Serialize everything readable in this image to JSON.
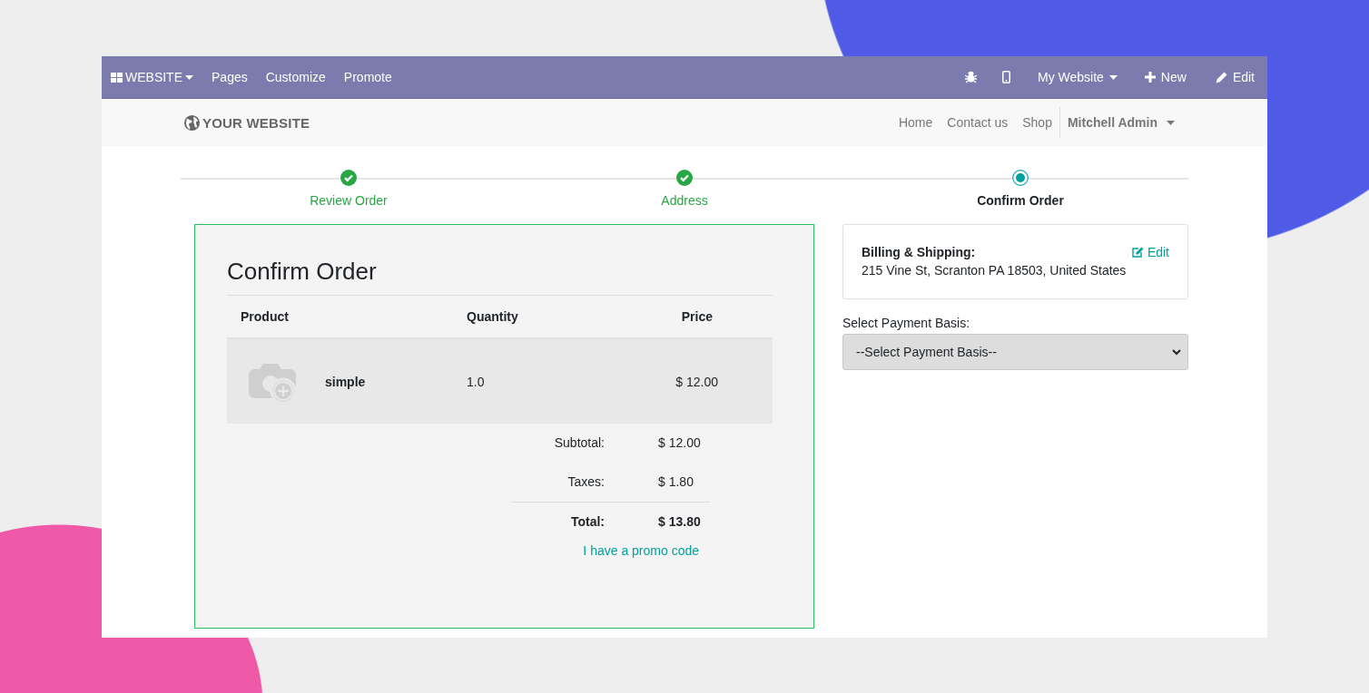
{
  "admin_bar": {
    "app_menu": "WEBSITE",
    "menu": [
      "Pages",
      "Customize",
      "Promote"
    ],
    "website_switcher": "My Website",
    "new_button": "New",
    "edit_button": "Edit"
  },
  "site_header": {
    "logo": "YOUR WEBSITE",
    "nav": [
      "Home",
      "Contact us",
      "Shop"
    ],
    "user_menu": "Mitchell Admin"
  },
  "steps": [
    {
      "label": "Review Order",
      "kind": "done"
    },
    {
      "label": "Address",
      "kind": "done"
    },
    {
      "label": "Confirm Order",
      "kind": "current"
    }
  ],
  "order": {
    "title": "Confirm Order",
    "columns": [
      "Product",
      "Quantity",
      "Price"
    ],
    "rows": [
      {
        "product": "simple",
        "quantity": "1.0",
        "price": "$ 12.00"
      }
    ],
    "totals": [
      {
        "label": "Subtotal:",
        "value": "$ 12.00",
        "kind": "line"
      },
      {
        "label": "Taxes:",
        "value": "$ 1.80",
        "kind": "line"
      },
      {
        "label": "Total:",
        "value": "$ 13.80",
        "kind": "total"
      }
    ],
    "promo_link": "I have a promo code"
  },
  "billing": {
    "heading": "Billing & Shipping:",
    "address": "215 Vine St, Scranton PA 18503, United States",
    "edit_link": "Edit"
  },
  "payment": {
    "label": "Select Payment Basis:",
    "value": "--Select Payment Basis--"
  }
}
